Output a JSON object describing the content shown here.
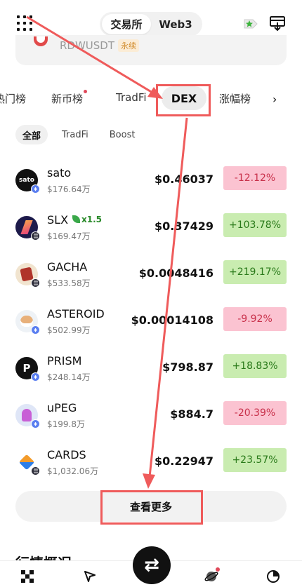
{
  "header": {
    "segments": [
      "交易所",
      "Web3"
    ],
    "active_segment": "交易所",
    "icons": [
      "grid-menu-icon",
      "favorite-star-icon",
      "download-icon"
    ]
  },
  "banner": {
    "symbol": "RDWUSDT",
    "tag": "永续"
  },
  "category_tabs": [
    "热门榜",
    "新币榜",
    "TradFi",
    "DEX",
    "涨幅榜"
  ],
  "active_category": "DEX",
  "sub_tabs": [
    "全部",
    "TradFi",
    "Boost"
  ],
  "active_sub_tab": "全部",
  "tokens": [
    {
      "symbol": "sato",
      "volume": "$176.64万",
      "price": "$0.46037",
      "change": "-12.12%",
      "direction": "down",
      "chain": "eth"
    },
    {
      "symbol": "SLX",
      "boost": "x1.5",
      "volume": "$169.47万",
      "price": "$0.37429",
      "change": "+103.78%",
      "direction": "up",
      "chain": "base"
    },
    {
      "symbol": "GACHA",
      "volume": "$533.58万",
      "price": "$0.0048416",
      "change": "+219.17%",
      "direction": "up",
      "chain": "base"
    },
    {
      "symbol": "ASTEROID",
      "volume": "$502.99万",
      "price": "$0.00014108",
      "change": "-9.92%",
      "direction": "down",
      "chain": "eth"
    },
    {
      "symbol": "PRISM",
      "volume": "$248.14万",
      "price": "$798.87",
      "change": "+18.83%",
      "direction": "up",
      "chain": "eth"
    },
    {
      "symbol": "uPEG",
      "volume": "$199.8万",
      "price": "$884.7",
      "change": "-20.39%",
      "direction": "down",
      "chain": "eth"
    },
    {
      "symbol": "CARDS",
      "volume": "$1,032.06万",
      "price": "$0.22947",
      "change": "+23.57%",
      "direction": "up",
      "chain": "base"
    }
  ],
  "view_more": "查看更多",
  "section_title": "行情概况",
  "bottom_nav_icons": [
    "home-icon",
    "discover-icon",
    "trade-swap-icon",
    "planet-icon",
    "assets-pie-icon"
  ],
  "colors": {
    "annotation": "#ef5b5b",
    "up_bg": "#c9ecb0",
    "down_bg": "#fbc3d1"
  }
}
